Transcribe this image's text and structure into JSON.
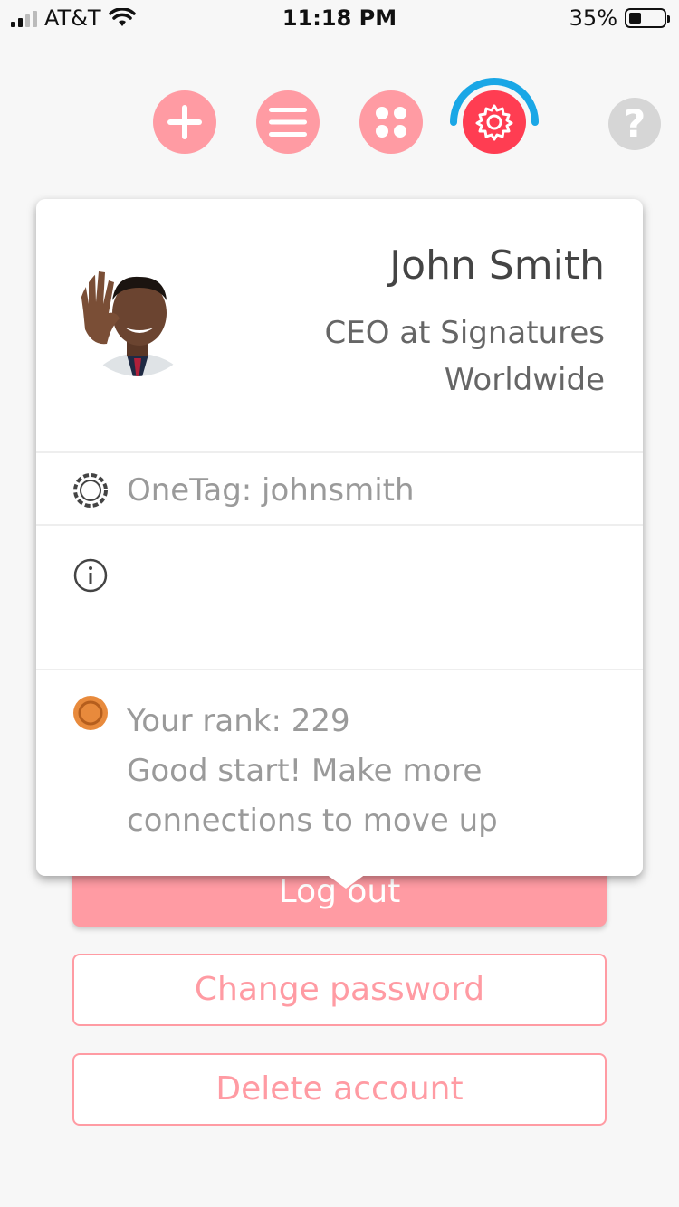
{
  "status_bar": {
    "carrier": "AT&T",
    "time": "11:18 PM",
    "battery_percent": "35%",
    "battery_level": 0.35
  },
  "nav": {
    "items": [
      {
        "icon": "plus-icon"
      },
      {
        "icon": "menu-icon"
      },
      {
        "icon": "apps-icon"
      },
      {
        "icon": "gear-icon",
        "active": true
      },
      {
        "icon": "help-icon",
        "label": "?"
      }
    ]
  },
  "profile": {
    "name": "John Smith",
    "title_line1": "CEO at Signatures",
    "title_line2": "Worldwide",
    "onetag": "OneTag: johnsmith",
    "rank_line1": "Your rank: 229",
    "rank_line2": "Good start! Make more",
    "rank_line3": "connections to move up"
  },
  "actions": {
    "logout": "Log out",
    "change_password": "Change password",
    "delete_account": "Delete account"
  },
  "colors": {
    "accent_pink": "#ff9ba3",
    "accent_red": "#ff3d52",
    "arc_blue": "#1aa7e6",
    "rank_orange": "#e88a3c"
  }
}
